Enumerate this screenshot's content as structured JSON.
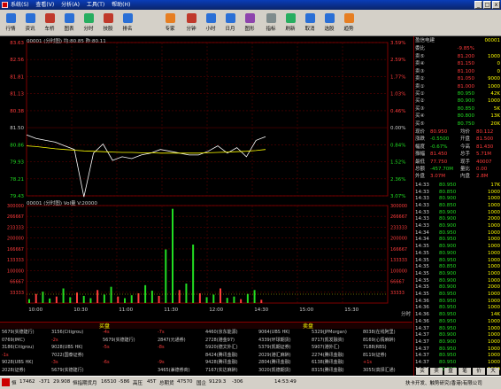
{
  "window": {
    "menu": [
      "系统(S)",
      "查看(V)",
      "分析(A)",
      "工具(T)",
      "帮助(H)"
    ],
    "min": "_",
    "max": "□",
    "close": "x"
  },
  "toolbar": {
    "items": [
      {
        "label": "行情",
        "icon": "quote-icon",
        "color": "#2a6fd6"
      },
      {
        "label": "资讯",
        "icon": "news-icon",
        "color": "#2a6fd6"
      },
      {
        "label": "车桥",
        "icon": "bridge-icon",
        "color": "#c0392b"
      },
      {
        "label": "图表",
        "icon": "chart-icon",
        "color": "#2a6fd6"
      },
      {
        "label": "分时",
        "icon": "tick-icon",
        "color": "#27ae60"
      },
      {
        "label": "技股",
        "icon": "tech-icon",
        "color": "#c0392b"
      },
      {
        "label": "排名",
        "icon": "rank-icon",
        "color": "#2a6fd6"
      },
      {
        "label": "专家",
        "icon": "expert-icon",
        "color": "#e67e22"
      },
      {
        "label": "分钟",
        "icon": "minute-icon",
        "color": "#c0392b"
      },
      {
        "label": "小时",
        "icon": "hour-icon",
        "color": "#2a6fd6"
      },
      {
        "label": "日月",
        "icon": "day-icon",
        "color": "#2a6fd6"
      },
      {
        "label": "图形",
        "icon": "shape-icon",
        "color": "#8e44ad"
      },
      {
        "label": "指标",
        "icon": "indicator-icon",
        "color": "#7f8c8d"
      },
      {
        "label": "刷新",
        "icon": "refresh-icon",
        "color": "#27ae60"
      },
      {
        "label": "取消",
        "icon": "cancel-icon",
        "color": "#2a6fd6"
      },
      {
        "label": "选股",
        "icon": "pick-icon",
        "color": "#2a6fd6"
      },
      {
        "label": "趋势",
        "icon": "trend-icon",
        "color": "#e67e22"
      }
    ]
  },
  "chart": {
    "price_header": "00001 (分时图)  均:80.85  昨:80.11",
    "volume_header": "00001 (分时图)  Vol量  V:20000",
    "price_left_ticks": [
      "83.63",
      "82.56",
      "81.81",
      "81.13",
      "80.38",
      "81.50",
      "80.86",
      "79.93",
      "78.21",
      "79.43"
    ],
    "price_right_ticks": [
      "3.59%",
      "2.59%",
      "1.77%",
      "1.03%",
      "0.46%",
      "0.00%",
      "0.84%",
      "1.52%",
      "2.36%",
      "3.07%"
    ],
    "vol_left_ticks": [
      "300000",
      "266667",
      "233333",
      "200000",
      "166667",
      "133333",
      "100000",
      "66667",
      "33333"
    ],
    "vol_right_ticks": [
      "300000",
      "266667",
      "233333",
      "200000",
      "166667",
      "133333",
      "100000",
      "66667",
      "33333"
    ],
    "time_ticks": [
      "10:00",
      "10:30",
      "11:00",
      "11:30",
      "12:00",
      "14:30",
      "15:00",
      "15:30"
    ],
    "corner_label": "分时"
  },
  "chart_data": {
    "type": "line",
    "title": "00001 (分时图)",
    "series": [
      {
        "name": "均",
        "values": [
          80.8,
          80.78,
          80.75,
          80.72,
          80.7,
          80.68,
          80.66,
          80.65,
          80.64,
          80.63,
          80.62,
          80.62,
          80.61,
          80.61,
          80.6,
          80.6,
          80.6,
          80.6,
          80.6,
          80.61,
          80.62,
          80.63,
          80.64,
          80.65,
          80.67,
          80.7
        ]
      }
    ],
    "price_values": [
      81.1,
      81.0,
      80.95,
      80.9,
      80.8,
      80.7,
      79.4,
      80.6,
      80.85,
      80.4,
      80.5,
      80.45,
      80.55,
      80.6,
      80.7,
      80.65,
      80.6,
      80.55,
      80.55,
      80.65,
      80.8,
      80.6,
      80.75,
      80.5,
      80.95,
      81.05
    ],
    "ylim": [
      79.43,
      83.63
    ],
    "volume_values": [
      12000,
      28000,
      35000,
      14000,
      20000,
      45000,
      18000,
      32000,
      22000,
      15000,
      40000,
      26000,
      50000,
      20000,
      15000,
      24000,
      30000,
      55000,
      38000,
      22000,
      165000,
      290000,
      40000,
      60000,
      180000,
      30000,
      18000,
      26000,
      45000,
      16000,
      20000,
      12000,
      28000,
      40000,
      10000
    ],
    "volume_ylim": [
      0,
      300000
    ]
  },
  "trades": {
    "buy_header": "买盘",
    "sell_header": "卖盘",
    "rows": [
      [
        "5679(实德建行)",
        "3156(Citigrou)",
        "-4s",
        "-7s",
        "4460(京东能源)",
        "9064(UBS HK)",
        "5329(JPMorgan)",
        "8038(在线阿里)"
      ],
      [
        "0769(IMC)",
        "-2s",
        "5679(实德建行)",
        "2847(元通券)",
        "2728(港金97)",
        "4339(环球期货)",
        "8717(凯发融资)",
        "8169(心情麻醉)"
      ],
      [
        "3186(Citigrou)",
        "9028(UBS HK)",
        "-5s",
        "-8s",
        "5920(德文外汇)",
        "5379(凯期证券)",
        "5907(港外汇)",
        "7188(RBS)"
      ],
      [
        "-1s",
        "7022(国泰证券)",
        "",
        "",
        "8424(腾讯金融)",
        "2029(港汇麻醉)",
        "2274(腾讯金融)",
        "8119(证券)"
      ],
      [
        "9028(UBS HK)",
        "-3s",
        "-6s",
        "-9s",
        "9428(腾讯金融)",
        "2804(腾讯金融)",
        "6138(腾讯金融)",
        "+1s"
      ],
      [
        "2028(证券)",
        "5679(实德建行)",
        "",
        "3465(兼德券商)",
        "7167(实达麻醉)",
        "3020(凯德期货)",
        "8315(腾讯金融)",
        "3055(高择汇通)"
      ]
    ]
  },
  "quote_panel": {
    "title": "盈信电建",
    "code": "00001",
    "weibi_label": "委比",
    "weibi_value": "-9.85%",
    "asks": [
      {
        "label": "卖⑤",
        "price": "81.200",
        "vol": "1000"
      },
      {
        "label": "卖④",
        "price": "81.150",
        "vol": "0"
      },
      {
        "label": "卖③",
        "price": "81.100",
        "vol": "0"
      },
      {
        "label": "卖②",
        "price": "81.050",
        "vol": "9000"
      },
      {
        "label": "卖①",
        "price": "81.000",
        "vol": "1000"
      }
    ],
    "bids": [
      {
        "label": "买①",
        "price": "80.950",
        "vol": "42K"
      },
      {
        "label": "买②",
        "price": "80.900",
        "vol": "1000"
      },
      {
        "label": "买③",
        "price": "80.850",
        "vol": "5K"
      },
      {
        "label": "买④",
        "price": "80.800",
        "vol": "13K"
      },
      {
        "label": "买⑤",
        "price": "80.750",
        "vol": "20K"
      }
    ],
    "stats": [
      {
        "a": "现价",
        "b": "80.950",
        "c": "均价",
        "d": "80.112"
      },
      {
        "a": "涨跌",
        "b": "-0.5500",
        "c": "开盘",
        "d": "81.500"
      },
      {
        "a": "幅度",
        "b": "-0.67%",
        "c": "今高",
        "d": "81.430"
      },
      {
        "a": "振幅",
        "b": "81.450",
        "c": "总手",
        "d": "5.71M"
      },
      {
        "a": "最低",
        "b": "77.750",
        "c": "现手",
        "d": "40007"
      },
      {
        "a": "总额",
        "b": "-457.70M",
        "c": "量比",
        "d": "0.00"
      },
      {
        "a": "外盘",
        "b": "3.07M",
        "c": "内盘",
        "d": "2.8M"
      }
    ],
    "ticks": [
      {
        "t": "14:33",
        "p": "80.950",
        "v": "17K"
      },
      {
        "t": "14:33",
        "p": "80.850",
        "v": "1000"
      },
      {
        "t": "14:33",
        "p": "80.900",
        "v": "1000"
      },
      {
        "t": "14:33",
        "p": "80.850",
        "v": "1000"
      },
      {
        "t": "14:33",
        "p": "80.900",
        "v": "1000"
      },
      {
        "t": "14:33",
        "p": "80.900",
        "v": "2000"
      },
      {
        "t": "14:33",
        "p": "80.900",
        "v": "1000"
      },
      {
        "t": "14:34",
        "p": "80.950",
        "v": "1000"
      },
      {
        "t": "14:34",
        "p": "80.950",
        "v": "1000"
      },
      {
        "t": "14:35",
        "p": "80.900",
        "v": "1000"
      },
      {
        "t": "14:35",
        "p": "80.900",
        "v": "1000"
      },
      {
        "t": "14:35",
        "p": "80.950",
        "v": "1000"
      },
      {
        "t": "14:35",
        "p": "80.850",
        "v": "1000"
      },
      {
        "t": "14:35",
        "p": "80.900",
        "v": "1000"
      },
      {
        "t": "14:35",
        "p": "80.900",
        "v": "1000"
      },
      {
        "t": "14:35",
        "p": "80.900",
        "v": "2000"
      },
      {
        "t": "14:35",
        "p": "80.950",
        "v": "1000"
      },
      {
        "t": "14:36",
        "p": "80.950",
        "v": "1000"
      },
      {
        "t": "14:36",
        "p": "80.950",
        "v": "1000"
      },
      {
        "t": "14:36",
        "p": "80.950",
        "v": "14K"
      },
      {
        "t": "14:36",
        "p": "80.950",
        "v": "1000"
      },
      {
        "t": "14:37",
        "p": "80.950",
        "v": "1000"
      },
      {
        "t": "14:37",
        "p": "80.900",
        "v": "1000"
      },
      {
        "t": "14:37",
        "p": "80.900",
        "v": "1000"
      },
      {
        "t": "14:37",
        "p": "80.950",
        "v": "1000"
      },
      {
        "t": "14:37",
        "p": "80.950",
        "v": "1000"
      },
      {
        "t": "14:37",
        "p": "80.950",
        "v": "1000"
      },
      {
        "t": "14:37",
        "p": "80.950",
        "v": "1000"
      },
      {
        "t": "14:37",
        "p": "80.950",
        "v": "1000"
      },
      {
        "t": "14:37",
        "p": "80.950",
        "v": "1000"
      },
      {
        "t": "14:38",
        "p": "80.950",
        "v": "1000"
      },
      {
        "t": "14:38",
        "p": "80.950",
        "v": "1000"
      }
    ],
    "tabs": [
      "买",
      "卖",
      "盘",
      "笔",
      "价",
      "大"
    ]
  },
  "status": {
    "hsi_label": "恒",
    "hsi_value": "17462",
    "hsi_change": "-371",
    "hsi_vol": "29.908",
    "sec1_label": "恒指期货月",
    "sec1_value": "16510",
    "sec1_change": "-586",
    "sec2_label": "高压",
    "sec2_value": "45T",
    "sec3_label": "总期货",
    "sec3_value": "47570",
    "sec4_label": "国企",
    "sec4_value": "9129.3",
    "sec4_change": "-306",
    "clock": "14:53:49",
    "news": "扶卡开发、触势研究(香港)有限公司"
  }
}
